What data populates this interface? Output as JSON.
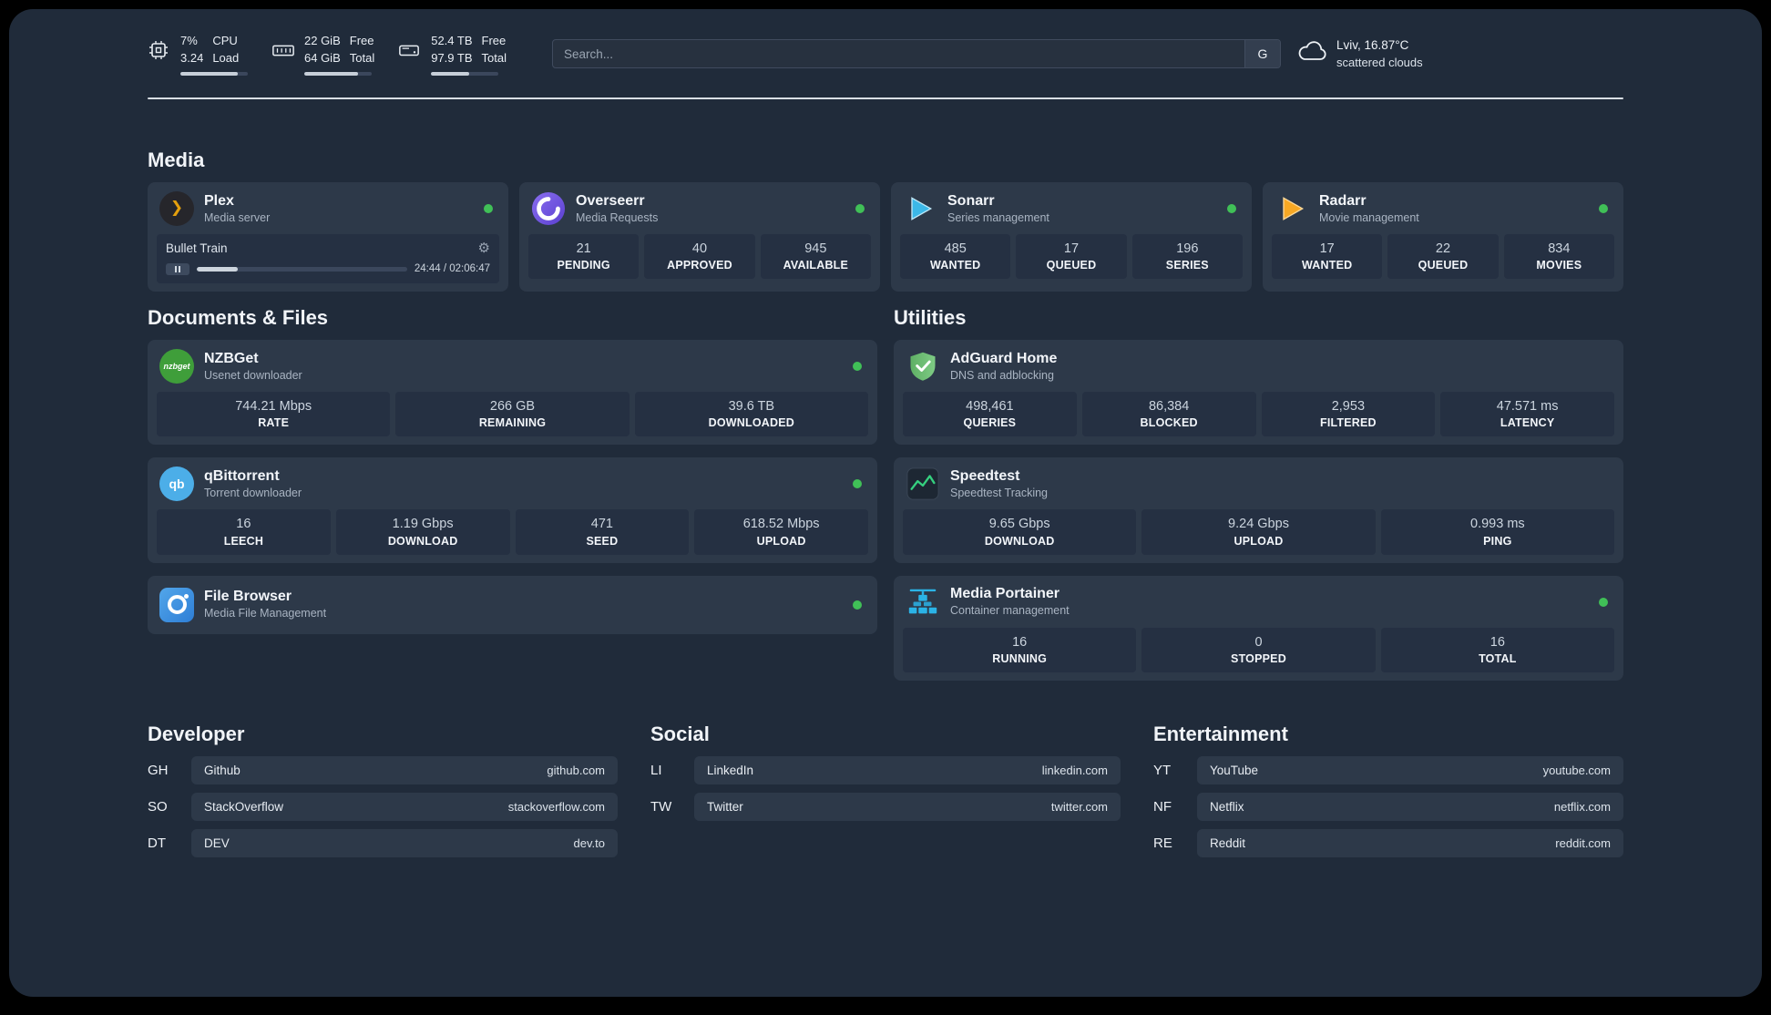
{
  "topbar": {
    "cpu": {
      "value_top": "7%",
      "value_bottom": "3.24",
      "label_top": "CPU",
      "label_bottom": "Load",
      "bar_fill_percent": 85
    },
    "memory": {
      "value_top": "22 GiB",
      "value_bottom": "64 GiB",
      "label_top": "Free",
      "label_bottom": "Total",
      "bar_fill_percent": 80
    },
    "storage": {
      "value_top": "52.4 TB",
      "value_bottom": "97.9 TB",
      "label_top": "Free",
      "label_bottom": "Total",
      "bar_fill_percent": 57
    },
    "search": {
      "placeholder": "Search...",
      "engine_button": "G"
    },
    "weather": {
      "location": "Lviv, 16.87°C",
      "condition": "scattered clouds"
    }
  },
  "icons": {
    "plex_glyph": "❯",
    "gear_glyph": "⚙",
    "nzbget_label": "nzbget",
    "qbittorrent_label": "qb"
  },
  "media": {
    "heading": "Media",
    "plex": {
      "title": "Plex",
      "subtitle": "Media server",
      "status": "online",
      "now_playing": {
        "track": "Bullet Train",
        "time": "24:44 / 02:06:47",
        "progress_percent": 19.5
      }
    },
    "overseerr": {
      "title": "Overseerr",
      "subtitle": "Media Requests",
      "status": "online",
      "stats": [
        {
          "value": "21",
          "label": "PENDING"
        },
        {
          "value": "40",
          "label": "APPROVED"
        },
        {
          "value": "945",
          "label": "AVAILABLE"
        }
      ]
    },
    "sonarr": {
      "title": "Sonarr",
      "subtitle": "Series management",
      "status": "online",
      "stats": [
        {
          "value": "485",
          "label": "WANTED"
        },
        {
          "value": "17",
          "label": "QUEUED"
        },
        {
          "value": "196",
          "label": "SERIES"
        }
      ]
    },
    "radarr": {
      "title": "Radarr",
      "subtitle": "Movie management",
      "status": "online",
      "stats": [
        {
          "value": "17",
          "label": "WANTED"
        },
        {
          "value": "22",
          "label": "QUEUED"
        },
        {
          "value": "834",
          "label": "MOVIES"
        }
      ]
    }
  },
  "documents": {
    "heading": "Documents & Files",
    "nzbget": {
      "title": "NZBGet",
      "subtitle": "Usenet downloader",
      "status": "online",
      "stats": [
        {
          "value": "744.21 Mbps",
          "label": "RATE"
        },
        {
          "value": "266 GB",
          "label": "REMAINING"
        },
        {
          "value": "39.6 TB",
          "label": "DOWNLOADED"
        }
      ]
    },
    "qbittorrent": {
      "title": "qBittorrent",
      "subtitle": "Torrent downloader",
      "status": "online",
      "stats": [
        {
          "value": "16",
          "label": "LEECH"
        },
        {
          "value": "1.19 Gbps",
          "label": "DOWNLOAD"
        },
        {
          "value": "471",
          "label": "SEED"
        },
        {
          "value": "618.52 Mbps",
          "label": "UPLOAD"
        }
      ]
    },
    "filebrowser": {
      "title": "File Browser",
      "subtitle": "Media File Management",
      "status": "online"
    }
  },
  "utilities": {
    "heading": "Utilities",
    "adguard": {
      "title": "AdGuard Home",
      "subtitle": "DNS and adblocking",
      "stats": [
        {
          "value": "498,461",
          "label": "QUERIES"
        },
        {
          "value": "86,384",
          "label": "BLOCKED"
        },
        {
          "value": "2,953",
          "label": "FILTERED"
        },
        {
          "value": "47.571 ms",
          "label": "LATENCY"
        }
      ]
    },
    "speedtest": {
      "title": "Speedtest",
      "subtitle": "Speedtest Tracking",
      "stats": [
        {
          "value": "9.65 Gbps",
          "label": "DOWNLOAD"
        },
        {
          "value": "9.24 Gbps",
          "label": "UPLOAD"
        },
        {
          "value": "0.993 ms",
          "label": "PING"
        }
      ]
    },
    "portainer": {
      "title": "Media Portainer",
      "subtitle": "Container management",
      "status": "online",
      "stats": [
        {
          "value": "16",
          "label": "RUNNING"
        },
        {
          "value": "0",
          "label": "STOPPED"
        },
        {
          "value": "16",
          "label": "TOTAL"
        }
      ]
    }
  },
  "bookmarks": {
    "developer": {
      "heading": "Developer",
      "items": [
        {
          "abbr": "GH",
          "name": "Github",
          "url": "github.com"
        },
        {
          "abbr": "SO",
          "name": "StackOverflow",
          "url": "stackoverflow.com"
        },
        {
          "abbr": "DT",
          "name": "DEV",
          "url": "dev.to"
        }
      ]
    },
    "social": {
      "heading": "Social",
      "items": [
        {
          "abbr": "LI",
          "name": "LinkedIn",
          "url": "linkedin.com"
        },
        {
          "abbr": "TW",
          "name": "Twitter",
          "url": "twitter.com"
        }
      ]
    },
    "entertainment": {
      "heading": "Entertainment",
      "items": [
        {
          "abbr": "YT",
          "name": "YouTube",
          "url": "youtube.com"
        },
        {
          "abbr": "NF",
          "name": "Netflix",
          "url": "netflix.com"
        },
        {
          "abbr": "RE",
          "name": "Reddit",
          "url": "reddit.com"
        }
      ]
    }
  },
  "colors": {
    "status_online": "#40c057",
    "page_bg": "#202b3a",
    "card_bg": "#2d3949",
    "tile_bg": "#253042",
    "plex_accent": "#e5a00d",
    "sonarr_accent": "#3cb8e8",
    "radarr_accent": "#f7a824",
    "adguard_accent": "#68b971",
    "portainer_accent": "#2bb3e6",
    "speedtest_accent": "#35d07f",
    "nzbget_accent": "#3f9e3a",
    "qbittorrent_accent": "#4caee8"
  }
}
